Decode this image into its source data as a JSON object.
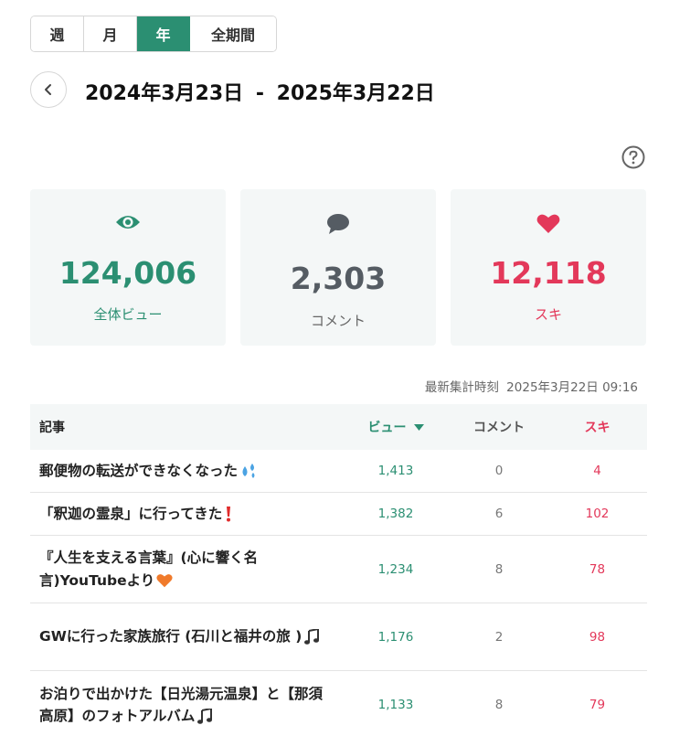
{
  "period_tabs": [
    {
      "label": "週",
      "active": false
    },
    {
      "label": "月",
      "active": false
    },
    {
      "label": "年",
      "active": true
    },
    {
      "label": "全期間",
      "active": false
    }
  ],
  "date_range": {
    "start": "2024年3月23日",
    "separator": "-",
    "end": "2025年3月22日"
  },
  "summary": {
    "views": {
      "value": "124,006",
      "label": "全体ビュー"
    },
    "comments": {
      "value": "2,303",
      "label": "コメント"
    },
    "likes": {
      "value": "12,118",
      "label": "スキ"
    }
  },
  "updated": {
    "label": "最新集計時刻",
    "value": "2025年3月22日 09:16"
  },
  "table": {
    "headers": {
      "title": "記事",
      "views": "ビュー",
      "comments": "コメント",
      "likes": "スキ"
    },
    "rows": [
      {
        "title": "郵便物の転送ができなくなった",
        "emoji": "sweat-drops-icon",
        "views": "1,413",
        "comments": "0",
        "likes": "4"
      },
      {
        "title": "「釈迦の霊泉」に行ってきた",
        "emoji": "exclamation-icon",
        "views": "1,382",
        "comments": "6",
        "likes": "102"
      },
      {
        "title": "『人生を支える言葉』(心に響く名言)YouTubeより",
        "emoji": "orange-heart-icon",
        "views": "1,234",
        "comments": "8",
        "likes": "78"
      },
      {
        "title": "GWに行った家族旅行 (石川と福井の旅 )",
        "emoji": "music-note-icon",
        "views": "1,176",
        "comments": "2",
        "likes": "98"
      },
      {
        "title": "お泊りで出かけた【日光湯元温泉】と【那須高原】のフォトアルバム",
        "emoji": "music-note-icon",
        "views": "1,133",
        "comments": "8",
        "likes": "79"
      }
    ]
  },
  "colors": {
    "views": "#2b8f72",
    "likes": "#e3385a",
    "comments": "#555c63"
  }
}
